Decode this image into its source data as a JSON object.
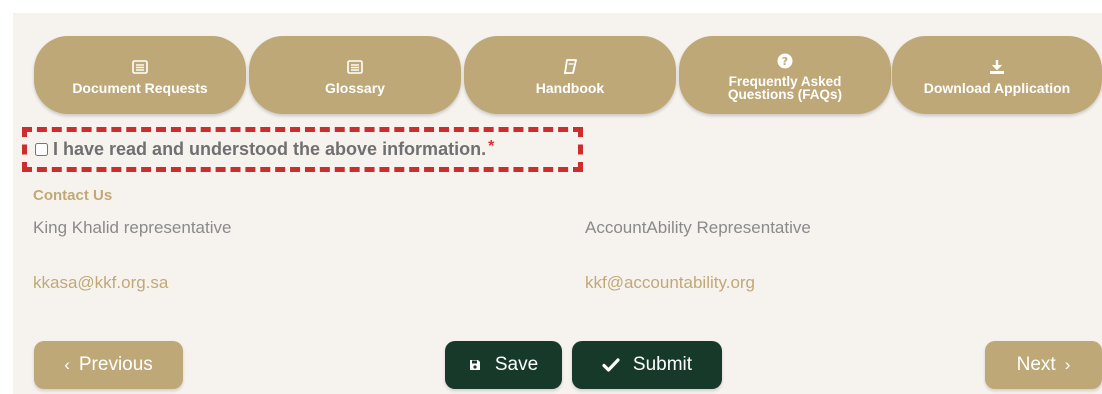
{
  "tabs": [
    {
      "label": "Document Requests",
      "icon": "document-list-icon"
    },
    {
      "label": "Glossary",
      "icon": "glossary-list-icon"
    },
    {
      "label": "Handbook",
      "icon": "book-icon"
    },
    {
      "label": "Frequently Asked Questions (FAQs)",
      "icon": "question-circle-icon"
    },
    {
      "label": "Download Application",
      "icon": "download-icon"
    }
  ],
  "acknowledgement": {
    "label": "I have read and understood the above information.",
    "required_mark": "*",
    "checked": false
  },
  "contact": {
    "heading": "Contact Us",
    "left": {
      "name": "King Khalid representative",
      "email": "kkasa@kkf.org.sa"
    },
    "right": {
      "name": "AccountAbility Representative",
      "email": "kkf@accountability.org"
    }
  },
  "buttons": {
    "previous": "Previous",
    "save": "Save",
    "submit": "Submit",
    "next": "Next"
  },
  "colors": {
    "gold": "#bfa878",
    "dark_green": "#16392a",
    "highlight_red": "#cc2d2d",
    "background": "#f6f3ef"
  }
}
